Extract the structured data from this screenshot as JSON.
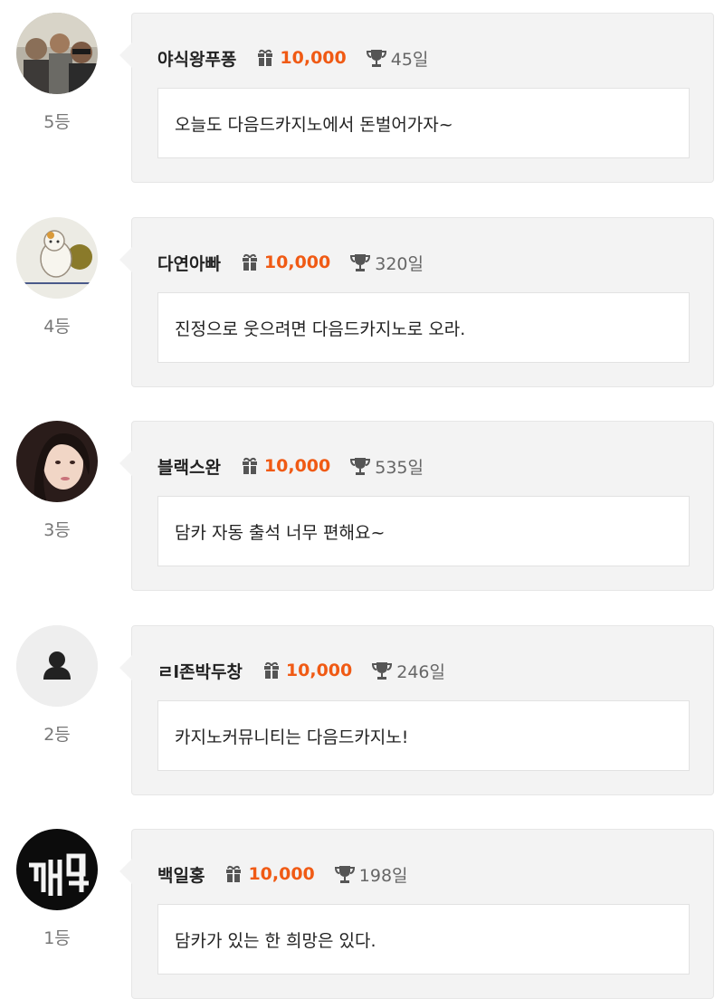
{
  "entries": [
    {
      "rank": "5등",
      "name": "야식왕푸퐁",
      "gift": "10,000",
      "days": "45일",
      "message": "오늘도 다음드카지노에서 돈벌어가자~",
      "avatar": "group-photo"
    },
    {
      "rank": "4등",
      "name": "다연아빠",
      "gift": "10,000",
      "days": "320일",
      "message": "진정으로 웃으려면 다음드카지노로 오라.",
      "avatar": "cat-drawing"
    },
    {
      "rank": "3등",
      "name": "블랙스완",
      "gift": "10,000",
      "days": "535일",
      "message": "담카 자동 출석 너무 편해요~",
      "avatar": "portrait-photo"
    },
    {
      "rank": "2등",
      "name": "ㄹl존박두창",
      "gift": "10,000",
      "days": "246일",
      "message": "카지노커뮤니티는 다음드카지노!",
      "avatar": "default-user"
    },
    {
      "rank": "1등",
      "name": "백일홍",
      "gift": "10,000",
      "days": "198일",
      "message": "담카가 있는 한 희망은 있다.",
      "avatar": "neon-sign"
    }
  ],
  "colors": {
    "accent": "#f05a14",
    "card_bg": "#f3f3f3",
    "text": "#222222",
    "muted": "#777777"
  }
}
